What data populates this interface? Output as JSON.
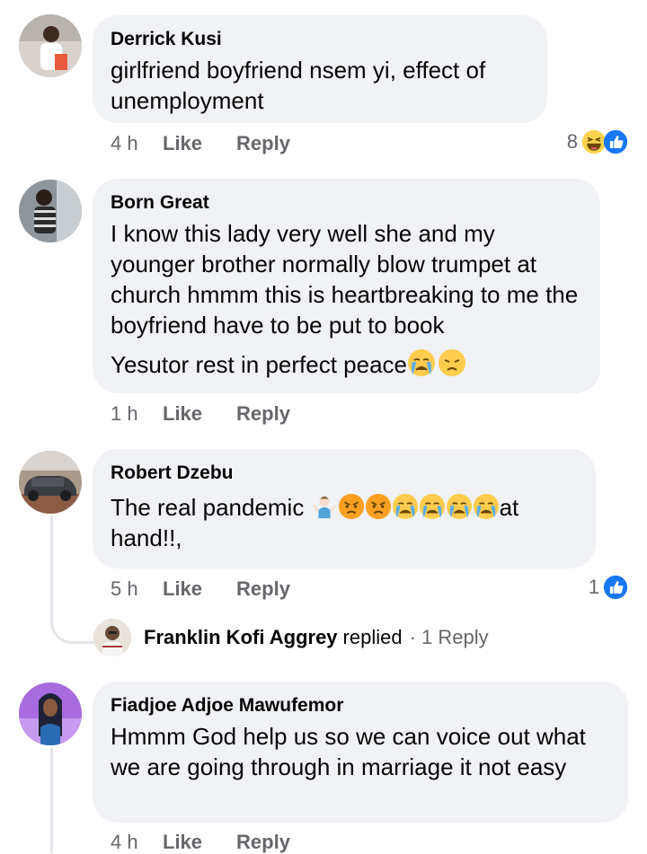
{
  "comments": [
    {
      "author": "Derrick Kusi",
      "paragraphs": [
        "girlfriend boyfriend nsem yi, effect of unemployment"
      ],
      "time": "4 h",
      "like_label": "Like",
      "reply_label": "Reply",
      "reaction_count": "8",
      "reaction_icons": [
        "haha-icon",
        "like-icon"
      ]
    },
    {
      "author": "Born Great",
      "paragraphs": [
        "I know this lady very well she and my younger brother normally blow trumpet at church hmmm this is heartbreaking to me the boyfriend have to be put to book",
        "Yesutor rest in perfect peace"
      ],
      "emojis_p2": [
        "crying-face-emoji",
        "disappointed-face-emoji"
      ],
      "time": "1 h",
      "like_label": "Like",
      "reply_label": "Reply"
    },
    {
      "author": "Robert Dzebu",
      "text_before": "The real pandemic ",
      "emojis": [
        "shrug-emoji",
        "angry-face-emoji",
        "angry-face-emoji",
        "crying-face-emoji",
        "crying-face-emoji",
        "crying-face-emoji",
        "crying-face-emoji"
      ],
      "text_after": "at hand!!,",
      "time": "5 h",
      "like_label": "Like",
      "reply_label": "Reply",
      "reaction_count": "1",
      "reaction_icons": [
        "like-icon"
      ],
      "reply_preview": {
        "author": "Franklin Kofi Aggrey",
        "word": "replied",
        "count": "· 1 Reply"
      }
    },
    {
      "author": "Fiadjoe Adjoe Mawufemor",
      "paragraphs": [
        "Hmmm God help us so we can voice out what we are going through in marriage it not easy"
      ],
      "time": "4 h",
      "like_label": "Like",
      "reply_label": "Reply"
    }
  ],
  "colors": {
    "bubble": "#f0f2f5",
    "meta_text": "#65676b",
    "like_blue": "#1877f2"
  }
}
